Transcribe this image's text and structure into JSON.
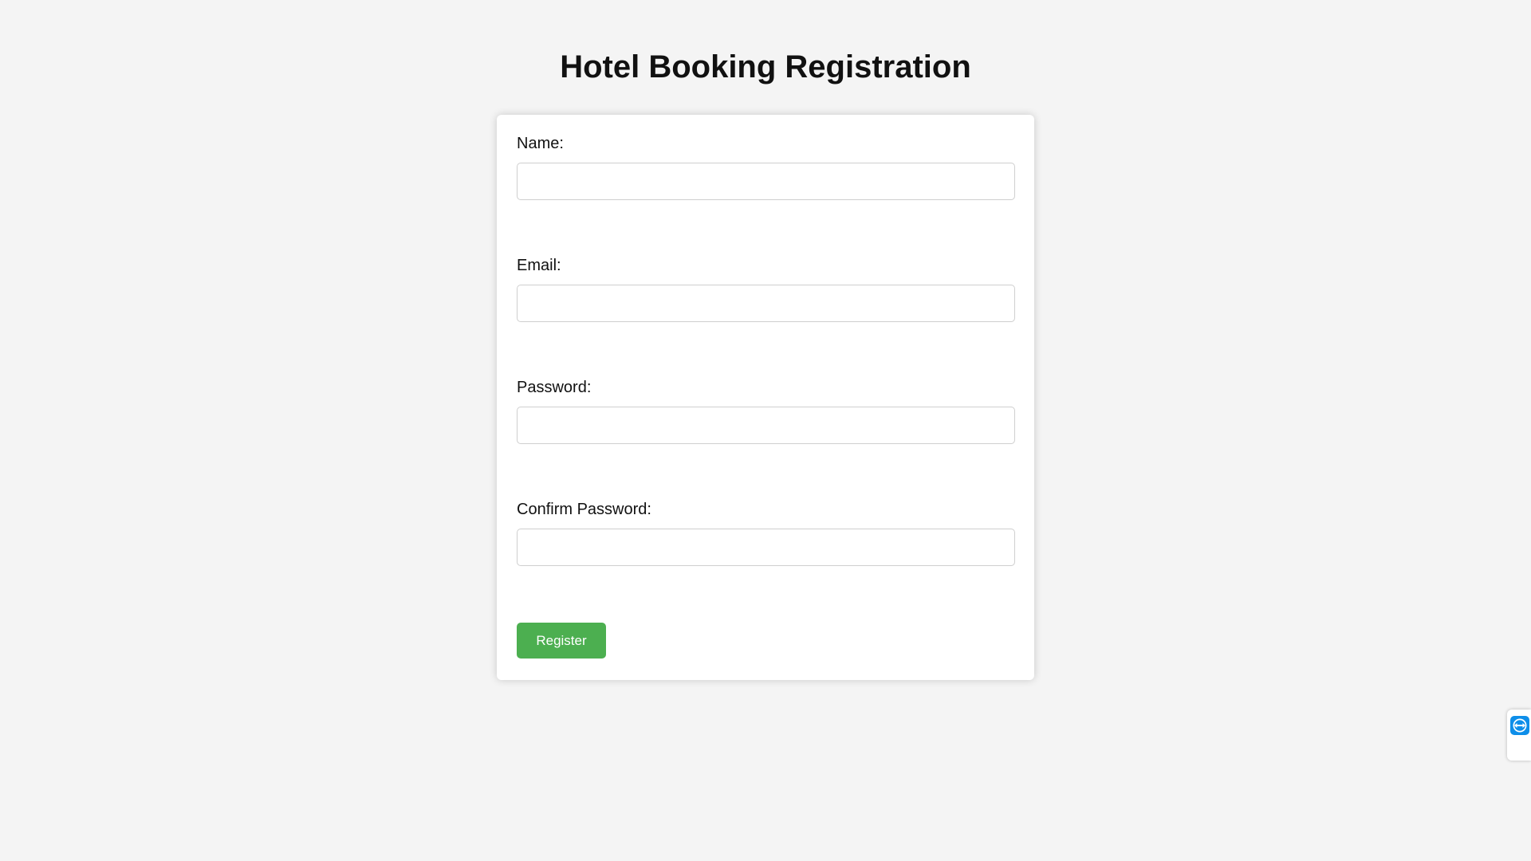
{
  "page": {
    "title": "Hotel Booking Registration"
  },
  "form": {
    "fields": [
      {
        "label": "Name:",
        "value": "",
        "placeholder": ""
      },
      {
        "label": "Email:",
        "value": "",
        "placeholder": ""
      },
      {
        "label": "Password:",
        "value": "",
        "placeholder": ""
      },
      {
        "label": "Confirm Password:",
        "value": "",
        "placeholder": ""
      }
    ],
    "submit_label": "Register"
  },
  "side_widget": {
    "icon": "remote-support-icon"
  },
  "colors": {
    "background": "#f4f4f4",
    "card": "#ffffff",
    "button": "#4caf50",
    "button_text": "#ffffff",
    "widget_icon": "#0e8ee9"
  }
}
